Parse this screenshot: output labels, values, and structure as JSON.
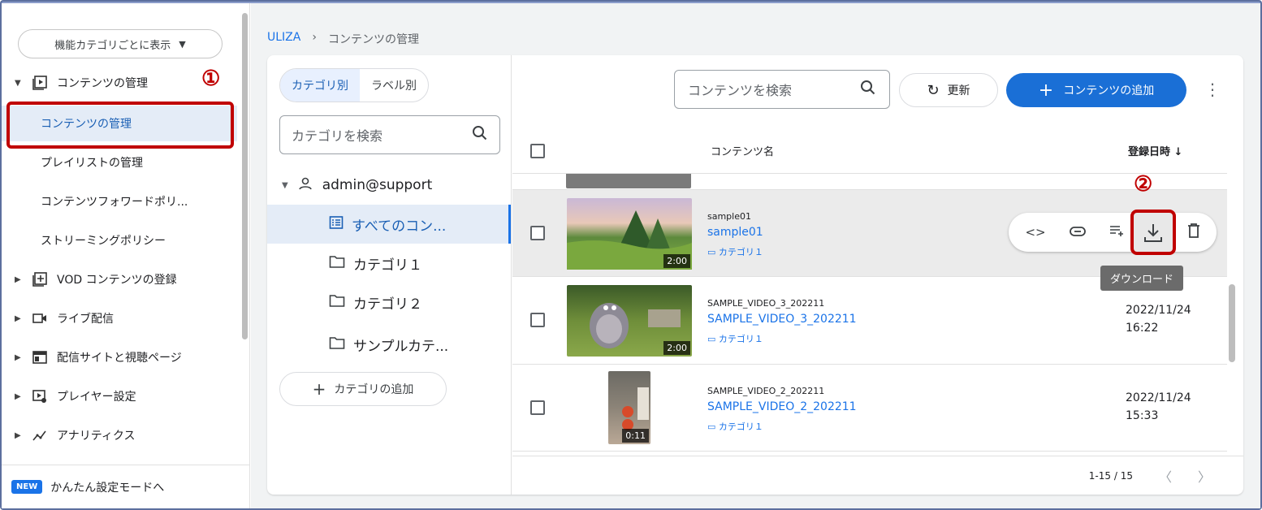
{
  "sidebar": {
    "view_toggle": "機能カテゴリごとに表示",
    "groups": [
      {
        "label": "コンテンツの管理",
        "icon": "video-library-icon"
      },
      {
        "label": "VOD コンテンツの登録",
        "icon": "add-box-icon"
      },
      {
        "label": "ライブ配信",
        "icon": "videocam-icon"
      },
      {
        "label": "配信サイトと視聴ページ",
        "icon": "web-page-icon"
      },
      {
        "label": "プレイヤー設定",
        "icon": "player-settings-icon"
      },
      {
        "label": "アナリティクス",
        "icon": "analytics-icon"
      }
    ],
    "sub_items": [
      "コンテンツの管理",
      "プレイリストの管理",
      "コンテンツフォワードポリ...",
      "ストリーミングポリシー"
    ],
    "bottom_badge": "NEW",
    "bottom_label": "かんたん設定モードへ"
  },
  "annotations": {
    "step1": "①",
    "step2": "②"
  },
  "breadcrumb": {
    "root": "ULIZA",
    "sep": "›",
    "current": "コンテンツの管理"
  },
  "category_panel": {
    "tab_category": "カテゴリ別",
    "tab_label": "ラベル別",
    "search_placeholder": "カテゴリを検索",
    "user": "admin@support",
    "items": [
      "すべてのコン...",
      "カテゴリ１",
      "カテゴリ２",
      "サンプルカテ..."
    ],
    "add_button": "カテゴリの追加"
  },
  "toolbar": {
    "search_placeholder": "コンテンツを検索",
    "refresh": "更新",
    "add": "コンテンツの追加"
  },
  "list": {
    "col_name": "コンテンツ名",
    "col_date": "登録日時",
    "rows": [
      {
        "id": "sample01",
        "title": "sample01",
        "category": "カテゴリ１",
        "duration": "2:00",
        "date": "",
        "time": ""
      },
      {
        "id": "SAMPLE_VIDEO_3_202211",
        "title": "SAMPLE_VIDEO_3_202211",
        "category": "カテゴリ１",
        "duration": "2:00",
        "date": "2022/11/24",
        "time": "16:22"
      },
      {
        "id": "SAMPLE_VIDEO_2_202211",
        "title": "SAMPLE_VIDEO_2_202211",
        "category": "カテゴリ１",
        "duration": "0:11",
        "date": "2022/11/24",
        "time": "15:33"
      }
    ],
    "tooltip": "ダウンロード",
    "pagination": "1-15 / 15"
  }
}
